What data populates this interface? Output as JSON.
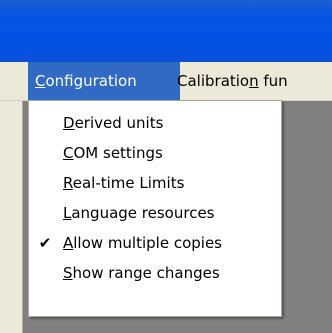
{
  "menubar": {
    "items": [
      {
        "pre": "",
        "key": "C",
        "post": "onfiguration"
      },
      {
        "pre": "Calibratio",
        "key": "n",
        "post": " fun"
      }
    ]
  },
  "menu": {
    "items": [
      {
        "pre": "",
        "key": "D",
        "post": "erived units",
        "checked": false
      },
      {
        "pre": "",
        "key": "C",
        "post": "OM settings",
        "checked": false
      },
      {
        "pre": "",
        "key": "R",
        "post": "eal-time Limits",
        "checked": false
      },
      {
        "pre": "",
        "key": "L",
        "post": "anguage resources",
        "checked": false
      },
      {
        "pre": "",
        "key": "A",
        "post": "llow multiple copies",
        "checked": true,
        "check_glyph": "✔"
      },
      {
        "pre": "",
        "key": "S",
        "post": "how range changes",
        "checked": false
      }
    ]
  }
}
